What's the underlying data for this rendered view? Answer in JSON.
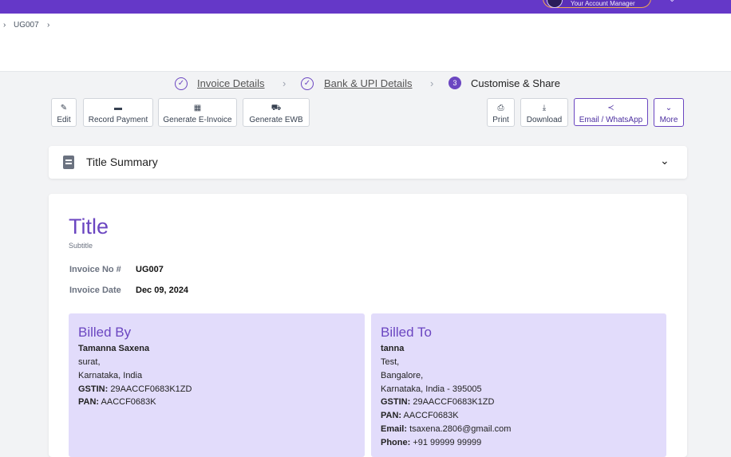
{
  "topbar": {
    "manager_label": "Your Account Manager"
  },
  "breadcrumb": {
    "current": "UG007"
  },
  "stepper": {
    "steps": [
      {
        "label": "Invoice Details",
        "state": "done"
      },
      {
        "label": "Bank & UPI Details",
        "state": "done"
      },
      {
        "label": "Customise & Share",
        "state": "current",
        "number": "3"
      }
    ]
  },
  "toolbar": {
    "edit": "Edit",
    "record_payment": "Record Payment",
    "generate_einvoice": "Generate E-Invoice",
    "generate_ewb": "Generate EWB",
    "print": "Print",
    "download": "Download",
    "email_whatsapp": "Email / WhatsApp",
    "more": "More"
  },
  "summary": {
    "title": "Title Summary"
  },
  "invoice": {
    "title": "Title",
    "subtitle": "Subtitle",
    "no_label": "Invoice No #",
    "no_value": "UG007",
    "date_label": "Invoice Date",
    "date_value": "Dec 09, 2024"
  },
  "billed_by": {
    "heading": "Billed By",
    "name": "Tamanna Saxena",
    "line1": "surat,",
    "line2": "Karnataka, India",
    "gstin_label": "GSTIN:",
    "gstin": "29AACCF0683K1ZD",
    "pan_label": "PAN:",
    "pan": "AACCF0683K"
  },
  "billed_to": {
    "heading": "Billed To",
    "name": "tanna",
    "line1": "Test,",
    "line2": "Bangalore,",
    "line3": "Karnataka, India - 395005",
    "gstin_label": "GSTIN:",
    "gstin": "29AACCF0683K1ZD",
    "pan_label": "PAN:",
    "pan": "AACCF0683K",
    "email_label": "Email:",
    "email": "tsaxena.2806@gmail.com",
    "phone_label": "Phone:",
    "phone": "+91 99999 99999"
  },
  "colors": {
    "brand": "#6538c8",
    "accent": "#6b46c1",
    "party_bg": "#e2dcfb"
  },
  "icons": [
    "check-circle-icon",
    "pencil-icon",
    "cash-icon",
    "qr-icon",
    "truck-icon",
    "printer-icon",
    "download-icon",
    "share-icon",
    "chevron-down-icon",
    "document-icon"
  ]
}
